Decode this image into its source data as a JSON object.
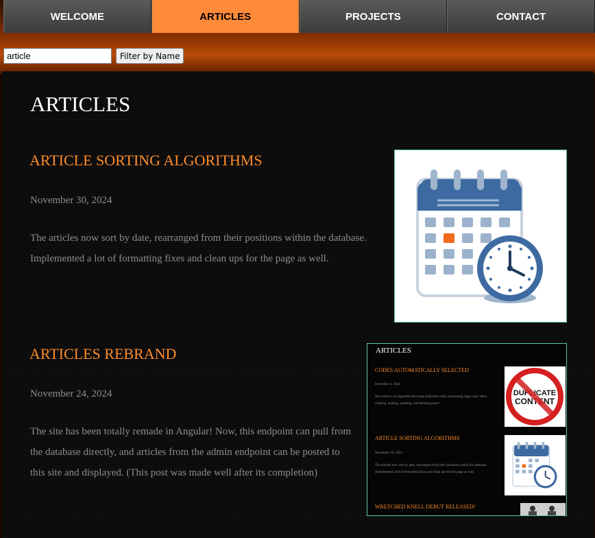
{
  "nav": {
    "tabs": [
      {
        "label": "WELCOME"
      },
      {
        "label": "ARTICLES",
        "active": true
      },
      {
        "label": "PROJECTS"
      },
      {
        "label": "CONTACT"
      }
    ]
  },
  "filter": {
    "value": "article",
    "button_label": "Filter by Name"
  },
  "page": {
    "title": "ARTICLES"
  },
  "articles": [
    {
      "title": "ARTICLE SORTING ALGORITHMS",
      "date": "November 30, 2024",
      "body": "The articles now sort by date, rearranged from their positions within the database. Implemented a lot of formatting fixes and clean ups for the page as well.",
      "image_icon": "calendar-clock-icon"
    },
    {
      "title": "ARTICLES REBRAND",
      "date": "November 24, 2024",
      "body": "The site has been totally remade in Angular! Now, this endpoint can pull from the database directly, and articles from the admin endpoint can be posted to this site and displayed. (This post was made well after its completion)",
      "image_icon": "articles-page-screenshot"
    }
  ],
  "screenshot": {
    "page_title": "ARTICLES",
    "articles": [
      {
        "title": "CODES AUTOMATICALLY SELECTED",
        "date": "December 4, 2024",
        "body": "Now there is an algorithm that stops duplicate codes, preventing edge cases when creating, reading, updating, and deleting posts!",
        "image_text": "DUPLICATE CONTENT"
      },
      {
        "title": "ARTICLE SORTING ALGORITHMS",
        "date": "November 30, 2024",
        "body": "The articles now sort by date, rearranged from their positions within the database. Implemented a lot of formatting fixes and clean ups for the page as well."
      },
      {
        "title": "WRETCHED KNELL DEBUT RELEASED!"
      }
    ]
  },
  "colors": {
    "accent": "#ff8a3a",
    "title_orange": "#ff8c2a",
    "text_gray": "#8d8d8d",
    "frame_border": "#5fc7b8",
    "calendar_blue": "#3d6aa1"
  }
}
